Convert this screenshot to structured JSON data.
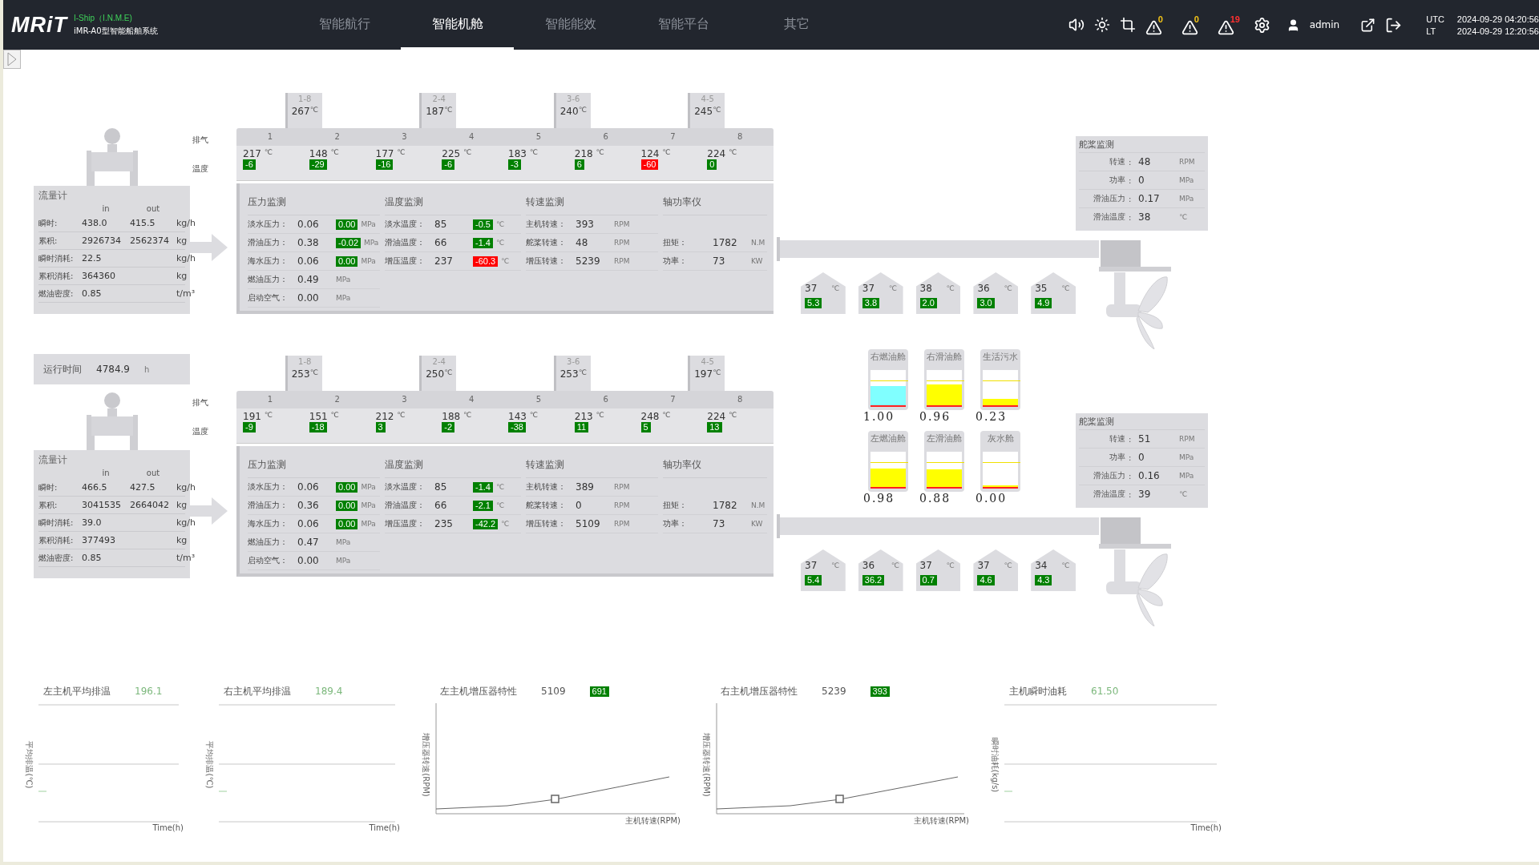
{
  "header": {
    "logo": "MRiT",
    "product": "I-Ship（I.N.M.E)",
    "system": "iMR-A0型智能船舶系统",
    "tabs": [
      {
        "label": "智能航行",
        "selected": false
      },
      {
        "label": "智能机舱",
        "selected": true
      },
      {
        "label": "智能能效",
        "selected": false
      },
      {
        "label": "智能平台",
        "selected": false
      },
      {
        "label": "其它",
        "selected": false
      }
    ],
    "alarms": [
      {
        "count": "0",
        "color": "#f5c518"
      },
      {
        "count": "0",
        "color": "#f5c518"
      },
      {
        "count": "19",
        "color": "#ff3030"
      }
    ],
    "user": "admin",
    "clocks": [
      {
        "zone": "UTC",
        "time": "2024-09-29 04:20:56"
      },
      {
        "zone": "LT",
        "time": "2024-09-29 12:20:56"
      }
    ]
  },
  "runtime": {
    "label": "运行时间",
    "value": "4784.9",
    "unit": "h"
  },
  "engines": [
    {
      "turbochargers": [
        {
          "label": "1-8",
          "value": "267",
          "unit": "℃"
        },
        {
          "label": "2-4",
          "value": "187",
          "unit": "℃"
        },
        {
          "label": "3-6",
          "value": "240",
          "unit": "℃"
        },
        {
          "label": "4-5",
          "value": "245",
          "unit": "℃"
        }
      ],
      "row_labels": [
        "排气",
        "温度"
      ],
      "cylinders": [
        {
          "num": "1",
          "temp": "217",
          "unit": "℃",
          "deviation": "-6",
          "alarm": false
        },
        {
          "num": "2",
          "temp": "148",
          "unit": "℃",
          "deviation": "-29",
          "alarm": false
        },
        {
          "num": "3",
          "temp": "177",
          "unit": "℃",
          "deviation": "-16",
          "alarm": false
        },
        {
          "num": "4",
          "temp": "225",
          "unit": "℃",
          "deviation": "-6",
          "alarm": false
        },
        {
          "num": "5",
          "temp": "183",
          "unit": "℃",
          "deviation": "-3",
          "alarm": false
        },
        {
          "num": "6",
          "temp": "218",
          "unit": "℃",
          "deviation": "6",
          "alarm": false
        },
        {
          "num": "7",
          "temp": "124",
          "unit": "℃",
          "deviation": "-60",
          "alarm": true
        },
        {
          "num": "8",
          "temp": "224",
          "unit": "℃",
          "deviation": "0",
          "alarm": false
        }
      ],
      "flowmeter": {
        "title": "流量计",
        "columns": [
          "in",
          "out"
        ],
        "rows": [
          {
            "label": "瞬时:",
            "values": [
              "438.0",
              "415.5"
            ],
            "unit": "kg/h"
          },
          {
            "label": "累积:",
            "values": [
              "2926734",
              "2562374"
            ],
            "unit": "kg"
          },
          {
            "label": "瞬时消耗:",
            "values": [
              "22.5"
            ],
            "unit": "kg/h"
          },
          {
            "label": "累积消耗:",
            "values": [
              "364360"
            ],
            "unit": "kg"
          },
          {
            "label": "燃油密度:",
            "values": [
              "0.85"
            ],
            "unit": "t/m³"
          }
        ]
      },
      "monitor": [
        {
          "title": "压力监测",
          "kind": "plain",
          "rows": [
            {
              "label": "淡水压力：",
              "value": "0.06",
              "unit": "MPa",
              "deviation": "0.00",
              "alarm": false
            },
            {
              "label": "滑油压力：",
              "value": "0.38",
              "unit": "MPa",
              "deviation": "-0.02",
              "alarm": false
            },
            {
              "label": "海水压力：",
              "value": "0.06",
              "unit": "MPa",
              "deviation": "0.00",
              "alarm": false
            },
            {
              "label": "燃油压力：",
              "value": "0.49",
              "unit": "MPa"
            },
            {
              "label": "启动空气：",
              "value": "0.00",
              "unit": "MPa"
            }
          ]
        },
        {
          "title": "温度监测",
          "kind": "plain",
          "rows": [
            {
              "label": "淡水温度：",
              "value": "85",
              "unit": "℃",
              "deviation": "-0.5",
              "alarm": false
            },
            {
              "label": "滑油温度：",
              "value": "66",
              "unit": "℃",
              "deviation": "-1.4",
              "alarm": false
            },
            {
              "label": "增压温度：",
              "value": "237",
              "unit": "℃",
              "deviation": "-60.3",
              "alarm": true
            }
          ]
        },
        {
          "title": "转速监测",
          "kind": "plain",
          "rows": [
            {
              "label": "主机转速：",
              "value": "393",
              "unit": "RPM"
            },
            {
              "label": "舵桨转速：",
              "value": "48",
              "unit": "RPM"
            },
            {
              "label": "增压转速：",
              "value": "5239",
              "unit": "RPM"
            }
          ]
        },
        {
          "title": "轴功率仪",
          "kind": "offset",
          "rows": [
            {
              "label": "扭矩：",
              "value": "1782",
              "unit": "N.M"
            },
            {
              "label": "功率：",
              "value": "73",
              "unit": "KW"
            }
          ]
        }
      ],
      "bearings": [
        {
          "value": "37",
          "unit": "℃",
          "deviation": "5.3"
        },
        {
          "value": "37",
          "unit": "℃",
          "deviation": "3.8"
        },
        {
          "value": "38",
          "unit": "℃",
          "deviation": "2.0"
        },
        {
          "value": "36",
          "unit": "℃",
          "deviation": "3.0"
        },
        {
          "value": "35",
          "unit": "℃",
          "deviation": "4.9"
        }
      ],
      "thruster": {
        "title": "舵桨监测",
        "rows": [
          {
            "label": "转速",
            "sep": ":",
            "value": "48",
            "unit": "RPM"
          },
          {
            "label": "功率",
            "sep": ":",
            "value": "0",
            "unit": "MPa"
          },
          {
            "label": "滑油压力",
            "sep": ":",
            "value": "0.17",
            "unit": "MPa"
          },
          {
            "label": "滑油温度",
            "sep": ":",
            "value": "38",
            "unit": "℃"
          }
        ]
      }
    },
    {
      "turbochargers": [
        {
          "label": "1-8",
          "value": "253",
          "unit": "℃"
        },
        {
          "label": "2-4",
          "value": "250",
          "unit": "℃"
        },
        {
          "label": "3-6",
          "value": "253",
          "unit": "℃"
        },
        {
          "label": "4-5",
          "value": "197",
          "unit": "℃"
        }
      ],
      "row_labels": [
        "排气",
        "温度"
      ],
      "cylinders": [
        {
          "num": "1",
          "temp": "191",
          "unit": "℃",
          "deviation": "-9",
          "alarm": false
        },
        {
          "num": "2",
          "temp": "151",
          "unit": "℃",
          "deviation": "-18",
          "alarm": false
        },
        {
          "num": "3",
          "temp": "212",
          "unit": "℃",
          "deviation": "3",
          "alarm": false
        },
        {
          "num": "4",
          "temp": "188",
          "unit": "℃",
          "deviation": "-2",
          "alarm": false
        },
        {
          "num": "5",
          "temp": "143",
          "unit": "℃",
          "deviation": "-38",
          "alarm": false
        },
        {
          "num": "6",
          "temp": "213",
          "unit": "℃",
          "deviation": "11",
          "alarm": false
        },
        {
          "num": "7",
          "temp": "248",
          "unit": "℃",
          "deviation": "5",
          "alarm": false
        },
        {
          "num": "8",
          "temp": "224",
          "unit": "℃",
          "deviation": "13",
          "alarm": false
        }
      ],
      "flowmeter": {
        "title": "流量计",
        "columns": [
          "in",
          "out"
        ],
        "rows": [
          {
            "label": "瞬时:",
            "values": [
              "466.5",
              "427.5"
            ],
            "unit": "kg/h"
          },
          {
            "label": "累积:",
            "values": [
              "3041535",
              "2664042"
            ],
            "unit": "kg"
          },
          {
            "label": "瞬时消耗:",
            "values": [
              "39.0"
            ],
            "unit": "kg/h"
          },
          {
            "label": "累积消耗:",
            "values": [
              "377493"
            ],
            "unit": "kg"
          },
          {
            "label": "燃油密度:",
            "values": [
              "0.85"
            ],
            "unit": "t/m³"
          }
        ]
      },
      "monitor": [
        {
          "title": "压力监测",
          "kind": "plain",
          "rows": [
            {
              "label": "淡水压力：",
              "value": "0.06",
              "unit": "MPa",
              "deviation": "0.00",
              "alarm": false
            },
            {
              "label": "滑油压力：",
              "value": "0.36",
              "unit": "MPa",
              "deviation": "0.00",
              "alarm": false
            },
            {
              "label": "海水压力：",
              "value": "0.06",
              "unit": "MPa",
              "deviation": "0.00",
              "alarm": false
            },
            {
              "label": "燃油压力：",
              "value": "0.47",
              "unit": "MPa"
            },
            {
              "label": "启动空气：",
              "value": "0.00",
              "unit": "MPa"
            }
          ]
        },
        {
          "title": "温度监测",
          "kind": "plain",
          "rows": [
            {
              "label": "淡水温度：",
              "value": "85",
              "unit": "℃",
              "deviation": "-1.4",
              "alarm": false
            },
            {
              "label": "滑油温度：",
              "value": "66",
              "unit": "℃",
              "deviation": "-2.1",
              "alarm": false
            },
            {
              "label": "增压温度：",
              "value": "235",
              "unit": "℃",
              "deviation": "-42.2",
              "alarm": false
            }
          ]
        },
        {
          "title": "转速监测",
          "kind": "plain",
          "rows": [
            {
              "label": "主机转速：",
              "value": "389",
              "unit": "RPM"
            },
            {
              "label": "舵桨转速：",
              "value": "0",
              "unit": "RPM"
            },
            {
              "label": "增压转速：",
              "value": "5109",
              "unit": "RPM"
            }
          ]
        },
        {
          "title": "轴功率仪",
          "kind": "offset",
          "rows": [
            {
              "label": "扭矩：",
              "value": "1782",
              "unit": "N.M"
            },
            {
              "label": "功率：",
              "value": "73",
              "unit": "KW"
            }
          ]
        }
      ],
      "bearings": [
        {
          "value": "37",
          "unit": "℃",
          "deviation": "5.4"
        },
        {
          "value": "36",
          "unit": "℃",
          "deviation": "36.2"
        },
        {
          "value": "37",
          "unit": "℃",
          "deviation": "0.7"
        },
        {
          "value": "37",
          "unit": "℃",
          "deviation": "4.6"
        },
        {
          "value": "34",
          "unit": "℃",
          "deviation": "4.3"
        }
      ],
      "thruster": {
        "title": "舵桨监测",
        "rows": [
          {
            "label": "转速",
            "sep": ":",
            "value": "51",
            "unit": "RPM"
          },
          {
            "label": "功率",
            "sep": ":",
            "value": "0",
            "unit": "MPa"
          },
          {
            "label": "滑油压力",
            "sep": ":",
            "value": "0.16",
            "unit": "MPa"
          },
          {
            "label": "滑油温度",
            "sep": ":",
            "value": "39",
            "unit": "℃"
          }
        ]
      }
    }
  ],
  "tanks": [
    {
      "name": "右燃油舱",
      "level": 0.55,
      "reading": "1.00",
      "color": "#80ffff"
    },
    {
      "name": "右滑油舱",
      "level": 0.6,
      "reading": "0.96",
      "color": "#ffff00"
    },
    {
      "name": "生活污水",
      "level": 0.18,
      "reading": "0.23",
      "color": "#ffff00"
    },
    {
      "name": "左燃油舱",
      "level": 0.52,
      "reading": "0.98",
      "color": "#ffff00"
    },
    {
      "name": "左滑油舱",
      "level": 0.5,
      "reading": "0.88",
      "color": "#ffff00"
    },
    {
      "name": "灰水舱",
      "level": 0,
      "reading": "0.00",
      "color": "#ffff00"
    }
  ],
  "charts": [
    {
      "kind": "trend",
      "title": "左主机平均排温",
      "value": "196.1",
      "ylabel": "平均排温(℃)",
      "xlabel": "Time(h)"
    },
    {
      "kind": "trend",
      "title": "右主机平均排温",
      "value": "189.4",
      "ylabel": "平均排温(℃)",
      "xlabel": "Time(h)"
    },
    {
      "kind": "curve",
      "title": "左主机增压器特性",
      "value": "5109",
      "badge": "691",
      "ylabel": "增压器转速(RPM)",
      "xlabel": "主机转速(RPM)"
    },
    {
      "kind": "curve",
      "title": "右主机增压器特性",
      "value": "5239",
      "badge": "393",
      "ylabel": "增压器转速(RPM)",
      "xlabel": "主机转速(RPM)"
    },
    {
      "kind": "trend",
      "title": "主机瞬时油耗",
      "value": "61.50",
      "ylabel": "瞬时油耗(kg/s)",
      "xlabel": "Time(h)"
    }
  ]
}
